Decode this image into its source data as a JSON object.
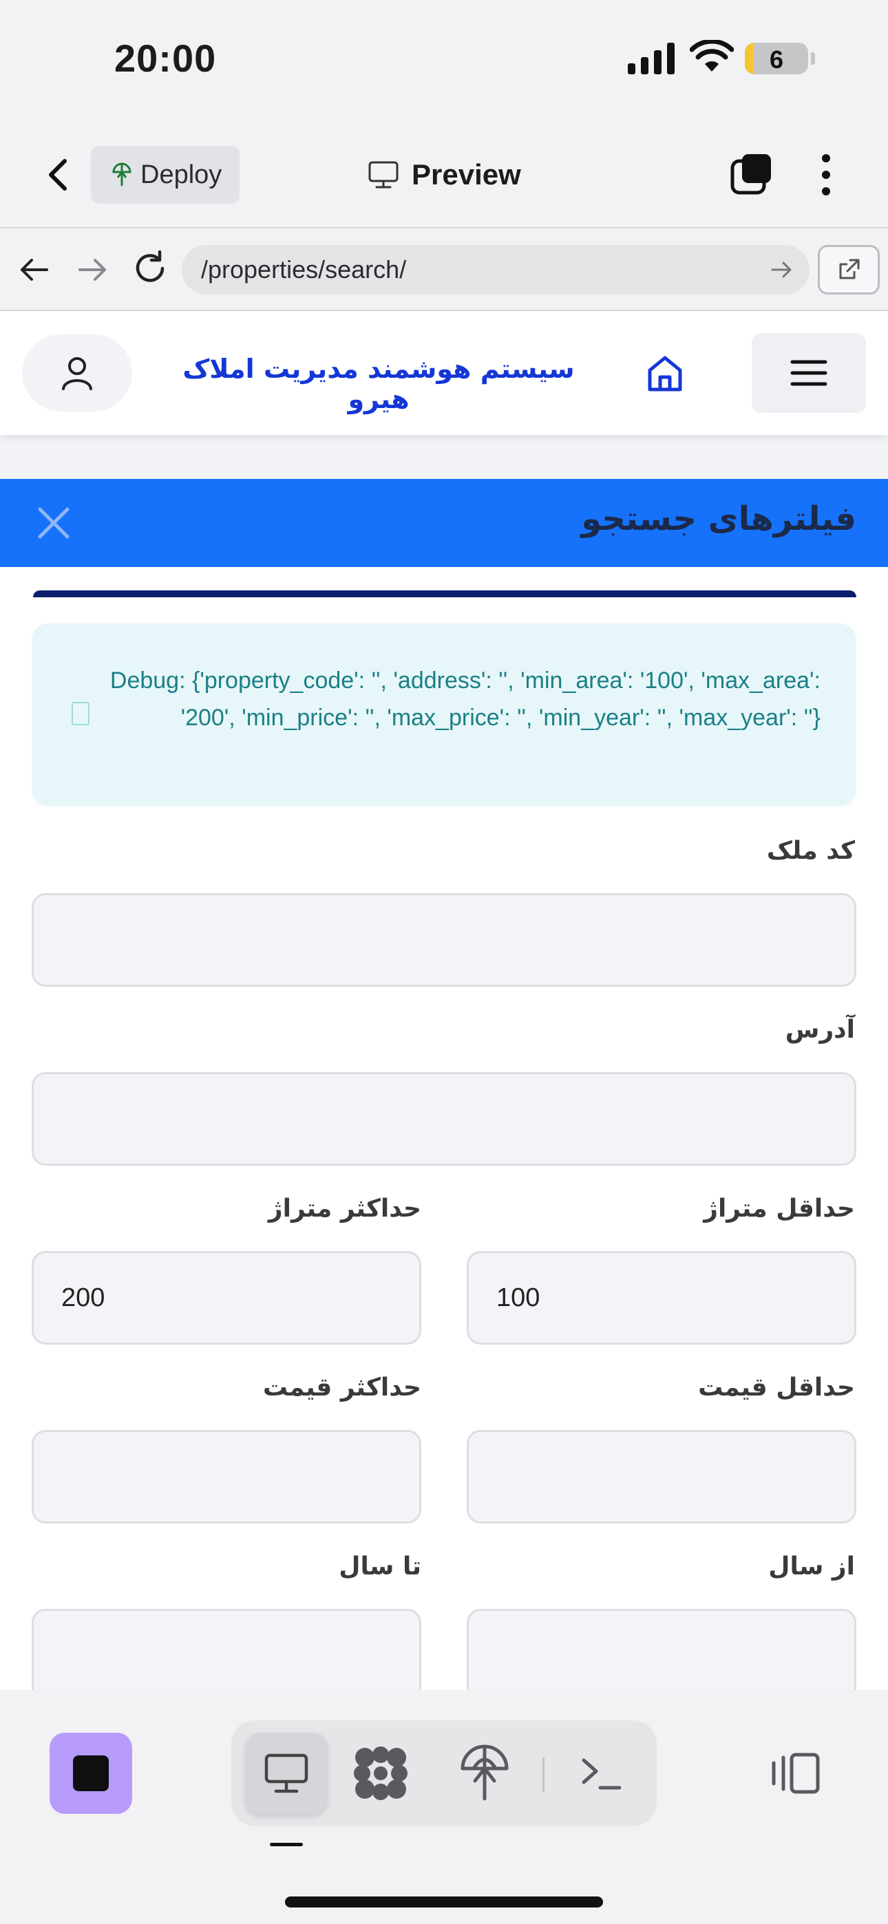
{
  "status_bar": {
    "time": "20:00",
    "battery_level": "6"
  },
  "app_header": {
    "deploy_label": "Deploy",
    "preview_label": "Preview"
  },
  "browser": {
    "url": "/properties/search/"
  },
  "site": {
    "title": "سیستم هوشمند مدیریت املاک هیرو"
  },
  "filters": {
    "title": "فیلترهای جستجو",
    "debug_text": "Debug: {'property_code': '', 'address': '', 'min_area': '100', 'max_area': '200', 'min_price': '', 'max_price': '', 'min_year': '', 'max_year': ''}",
    "fields": {
      "property_code": {
        "label": "کد ملک",
        "value": ""
      },
      "address": {
        "label": "آدرس",
        "value": ""
      },
      "min_area": {
        "label": "حداقل متراژ",
        "value": "100"
      },
      "max_area": {
        "label": "حداکثر متراژ",
        "value": "200"
      },
      "min_price": {
        "label": "حداقل قیمت",
        "value": ""
      },
      "max_price": {
        "label": "حداکثر قیمت",
        "value": ""
      },
      "min_year": {
        "label": "از سال",
        "value": ""
      },
      "max_year": {
        "label": "تا سال",
        "value": ""
      }
    }
  },
  "colors": {
    "brand_blue": "#1672fb",
    "title_blue": "#1437d6",
    "debug_bg": "#e7f7f9",
    "debug_text": "#1b7f86",
    "stop_button": "#b79cfb"
  },
  "icons": {
    "back": "chevron-left-icon",
    "deploy": "deploy-icon",
    "preview": "monitor-icon",
    "tabs": "tabs-icon",
    "more": "more-vertical-icon",
    "user": "user-icon",
    "home": "home-icon",
    "menu": "hamburger-menu-icon",
    "close": "close-icon",
    "console": "terminal-icon",
    "panel_toggle": "panel-toggle-icon"
  }
}
